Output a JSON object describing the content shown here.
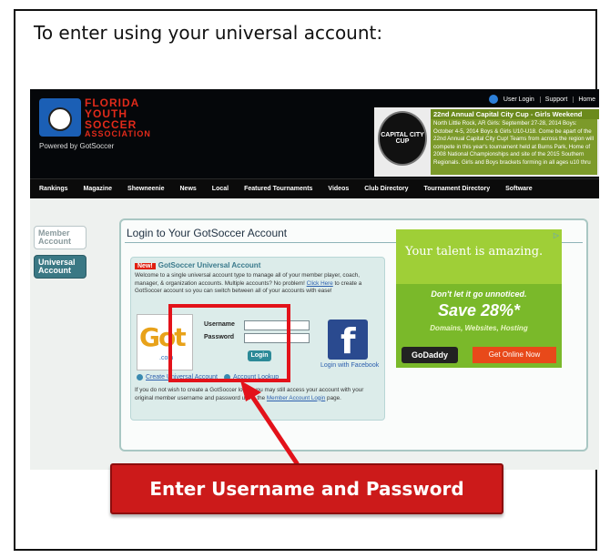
{
  "intro": "To enter using your universal account:",
  "header": {
    "logo_lines": [
      "FLORIDA",
      "YOUTH",
      "SOCCER",
      "ASSOCIATION"
    ],
    "powered_by": "Powered by GotSoccer",
    "top_links": [
      "User Login",
      "Support",
      "Home"
    ],
    "promo_title": "22nd Annual Capital City Cup - Girls Weekend",
    "promo_body": "North Little Rock, AR Girls: September 27-28, 2014 Boys: October 4-5, 2014 Boys & Girls U10-U18. Come be apart of the 22nd Annual Capital City Cup! Teams from across the region will compete in this year's tournament held at Burns Park, Home of 2008 National Championships and site of the 2015 Southern Regionals. Girls and Boys brackets forming in all ages u10 thru",
    "promo_badge": "CAPITAL CITY CUP",
    "nav": [
      "Rankings",
      "Magazine",
      "Shewneenie",
      "News",
      "Local",
      "Featured Tournaments",
      "Videos",
      "Club Directory",
      "Tournament Directory",
      "Software"
    ]
  },
  "sidebar": {
    "items": [
      {
        "label": "Member Account"
      },
      {
        "label": "Universal Account"
      }
    ]
  },
  "panel": {
    "title": "Login to Your GotSoccer Account",
    "new_badge": "New!",
    "box_title": "GotSoccer Universal Account",
    "welcome": "Welcome to a single universal account type to manage all of your member player, coach, manager, & organization accounts. Multiple accounts? No problem! ",
    "welcome_link": "Click Here",
    "welcome_tail": " to create a GotSoccer account so you can switch between all of your accounts with ease!",
    "got_logo": "Got",
    "got_logo_sub": ".com",
    "username_label": "Username",
    "password_label": "Password",
    "username_value": "",
    "password_value": "",
    "login_button": "Login",
    "facebook_glyph": "f",
    "facebook_label": "Login with Facebook",
    "create_link": "Create Universal Account",
    "lookup_link": "Account Lookup",
    "alt_text": "If you do not wish to create a GotSoccer login, you may still access your account with your original member username and password using the ",
    "alt_link": "Member Account Login",
    "alt_tail": " page."
  },
  "ad": {
    "headline": "Your talent is amazing.",
    "line1": "Don't let it go unnoticed.",
    "line2": "Save 28%*",
    "line3": "Domains, Websites, Hosting",
    "brand": "GoDaddy",
    "cta": "Get Online Now",
    "adchoice": "▷"
  },
  "callout": "Enter Username and Password",
  "colors": {
    "highlight": "#e3121a",
    "callout_bg": "#cc1a1a"
  }
}
